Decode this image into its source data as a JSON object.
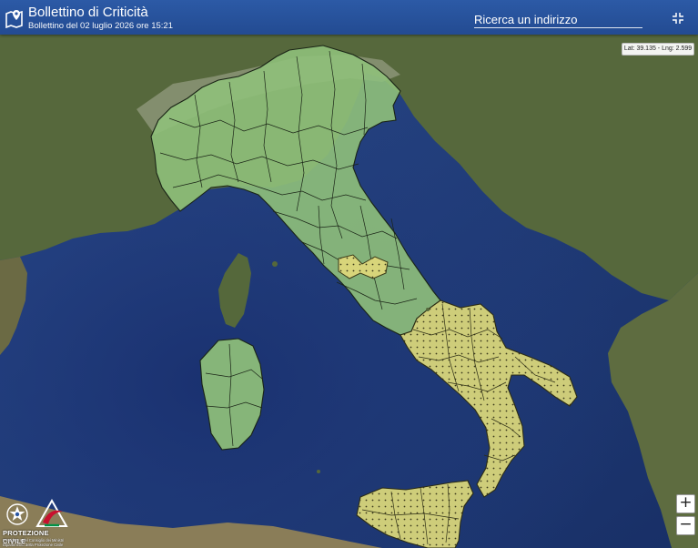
{
  "header": {
    "title": "Bollettino di Criticità",
    "subtitle": "Bollettino del 02 luglio 2026 ore 15:21",
    "search_placeholder": "Ricerca un indirizzo"
  },
  "map": {
    "coordinates_readout": "Lat: 39.135 - Lng: 2.599",
    "alert_levels": [
      {
        "level": "green",
        "color": "#8fc07a",
        "regions": [
          "Northern Italy",
          "Central Italy",
          "Sardinia"
        ]
      },
      {
        "level": "yellow",
        "color": "#d8d57a",
        "regions": [
          "Southern Italy",
          "Sicily",
          "Central Apennine area"
        ]
      }
    ],
    "controls": {
      "zoom_in": "+",
      "zoom_out": "−"
    }
  },
  "footer_logo": {
    "name": "PROTEZIONE CIVILE",
    "sub_line1": "Presidenza del Consiglio dei Ministri",
    "sub_line2": "Dipartimento della Protezione Civile"
  },
  "colors": {
    "header": "#2a57a3",
    "sea": "#1f3a78",
    "land": "#5a6a3e",
    "alert_green": "#8fc07a",
    "alert_yellow": "#d8d57a"
  }
}
